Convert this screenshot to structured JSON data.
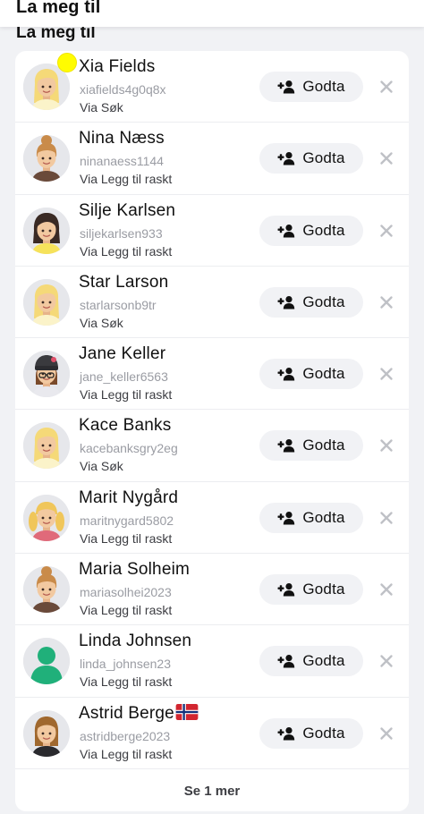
{
  "top_bar": {
    "title": "La meg til"
  },
  "section": {
    "title": "La meg til"
  },
  "requests": [
    {
      "name": "Xia Fields",
      "username": "xiafields4g0q8x",
      "source": "Via Søk",
      "action": "Godta",
      "avatar": "blonde",
      "highlight": true
    },
    {
      "name": "Nina Næss",
      "username": "ninanaess1144",
      "source": "Via Legg til raskt",
      "action": "Godta",
      "avatar": "bun"
    },
    {
      "name": "Silje Karlsen",
      "username": "siljekarlsen933",
      "source": "Via Legg til raskt",
      "action": "Godta",
      "avatar": "darkhair"
    },
    {
      "name": "Star Larson",
      "username": "starlarsonb9tr",
      "source": "Via Søk",
      "action": "Godta",
      "avatar": "blonde"
    },
    {
      "name": "Jane Keller",
      "username": "jane_keller6563",
      "source": "Via Legg til raskt",
      "action": "Godta",
      "avatar": "beanie"
    },
    {
      "name": "Kace Banks",
      "username": "kacebanksgry2eg",
      "source": "Via Søk",
      "action": "Godta",
      "avatar": "blonde"
    },
    {
      "name": "Marit Nygård",
      "username": "maritnygard5802",
      "source": "Via Legg til raskt",
      "action": "Godta",
      "avatar": "pigtails"
    },
    {
      "name": "Maria Solheim",
      "username": "mariasolhei2023",
      "source": "Via Legg til raskt",
      "action": "Godta",
      "avatar": "bun"
    },
    {
      "name": "Linda Johnsen",
      "username": "linda_johnsen23",
      "source": "Via Legg til raskt",
      "action": "Godta",
      "avatar": "placeholder"
    },
    {
      "name": "Astrid Berge",
      "username": "astridberge2023",
      "source": "Via Legg til raskt",
      "action": "Godta",
      "avatar": "brown",
      "flag": "norway-flag"
    }
  ],
  "footer": {
    "see_more": "Se 1 mer"
  },
  "colors": {
    "background": "#f1f2f5",
    "card": "#ffffff",
    "button": "#f1f2f5",
    "indicator": "#fffc00",
    "placeholder_avatar": "#20b07a",
    "username": "#9a9ca3"
  }
}
